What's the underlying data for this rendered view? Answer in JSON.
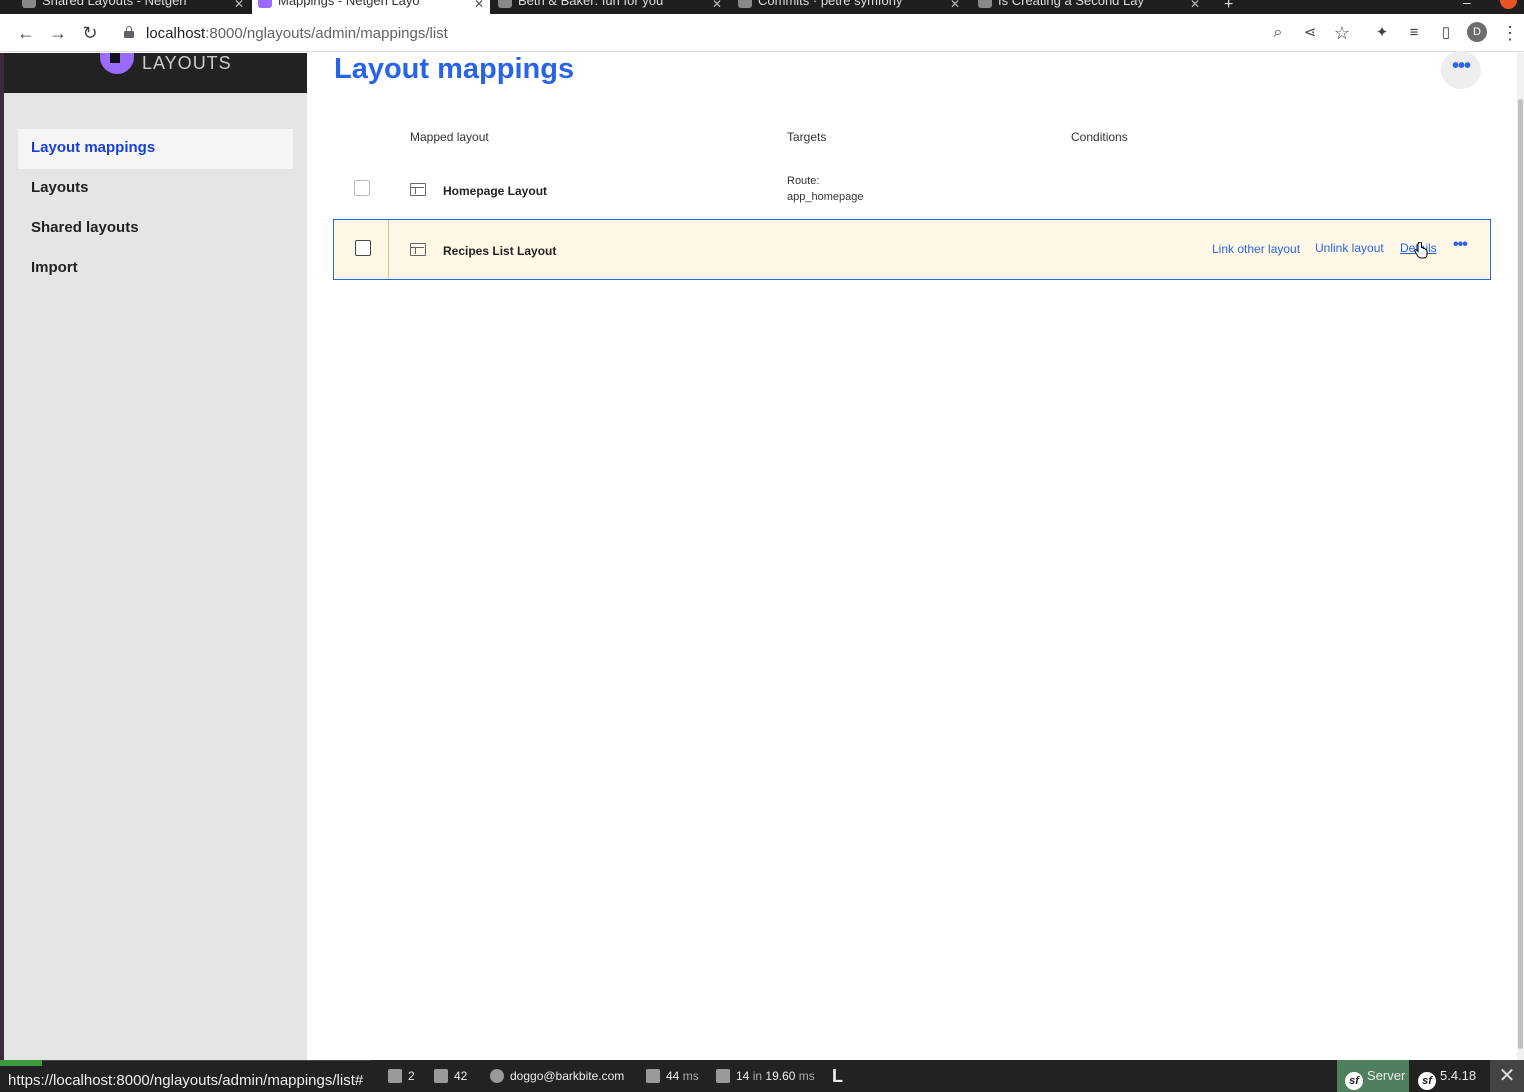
{
  "browser": {
    "tabs": [
      {
        "title": "Shared Layouts - Netgen",
        "active": false
      },
      {
        "title": "Mappings - Netgen Layo",
        "active": true
      },
      {
        "title": "Beth & Baker: fun for you",
        "active": false
      },
      {
        "title": "Commits · petre symfony",
        "active": false
      },
      {
        "title": "Is Creating a Second Lay",
        "active": false
      }
    ],
    "url_host": "localhost",
    "url_path": ":8000/nglayouts/admin/mappings/list",
    "profile_initial": "D",
    "status_url": "https://localhost:8000/nglayouts/admin/mappings/list#"
  },
  "brand": {
    "name": "LAYOUTS"
  },
  "sidebar": {
    "items": [
      {
        "label": "Layout mappings",
        "active": true
      },
      {
        "label": "Layouts",
        "active": false
      },
      {
        "label": "Shared layouts",
        "active": false
      },
      {
        "label": "Import",
        "active": false
      }
    ]
  },
  "page": {
    "title": "Layout mappings",
    "menu_label": "•••"
  },
  "table": {
    "headers": {
      "mapped_layout": "Mapped layout",
      "targets": "Targets",
      "conditions": "Conditions"
    },
    "rows": [
      {
        "name": "Homepage Layout",
        "target_type": "Route:",
        "target_value": "app_homepage"
      },
      {
        "name": "Recipes List Layout",
        "target_type": "",
        "target_value": ""
      }
    ],
    "row_actions": {
      "link_other": "Link other layout",
      "unlink": "Unlink layout",
      "details": "Details",
      "more": "•••"
    }
  },
  "debugbar": {
    "count_a": "2",
    "count_b": "42",
    "user": "doggo@barkbite.com",
    "time_value": "44",
    "time_unit": "ms",
    "db_queries": "14",
    "db_in": "in",
    "db_time": "19.60",
    "db_unit": "ms",
    "server_label": "Server",
    "version": "5.4.18"
  },
  "colors": {
    "accent": "#2a64e6",
    "nav_active": "#1a3fd6",
    "highlight_row": "#fff8e6",
    "server_green": "#4f805d"
  }
}
